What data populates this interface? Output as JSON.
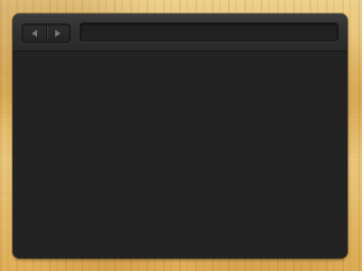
{
  "browser": {
    "nav": {
      "back_icon": "back-arrow-icon",
      "forward_icon": "forward-arrow-icon"
    },
    "address_bar": {
      "value": ""
    }
  },
  "theme": {
    "window_bg": "#242424",
    "toolbar_bg": "#2f2f2f",
    "wood_bg": "#e7c27a"
  }
}
